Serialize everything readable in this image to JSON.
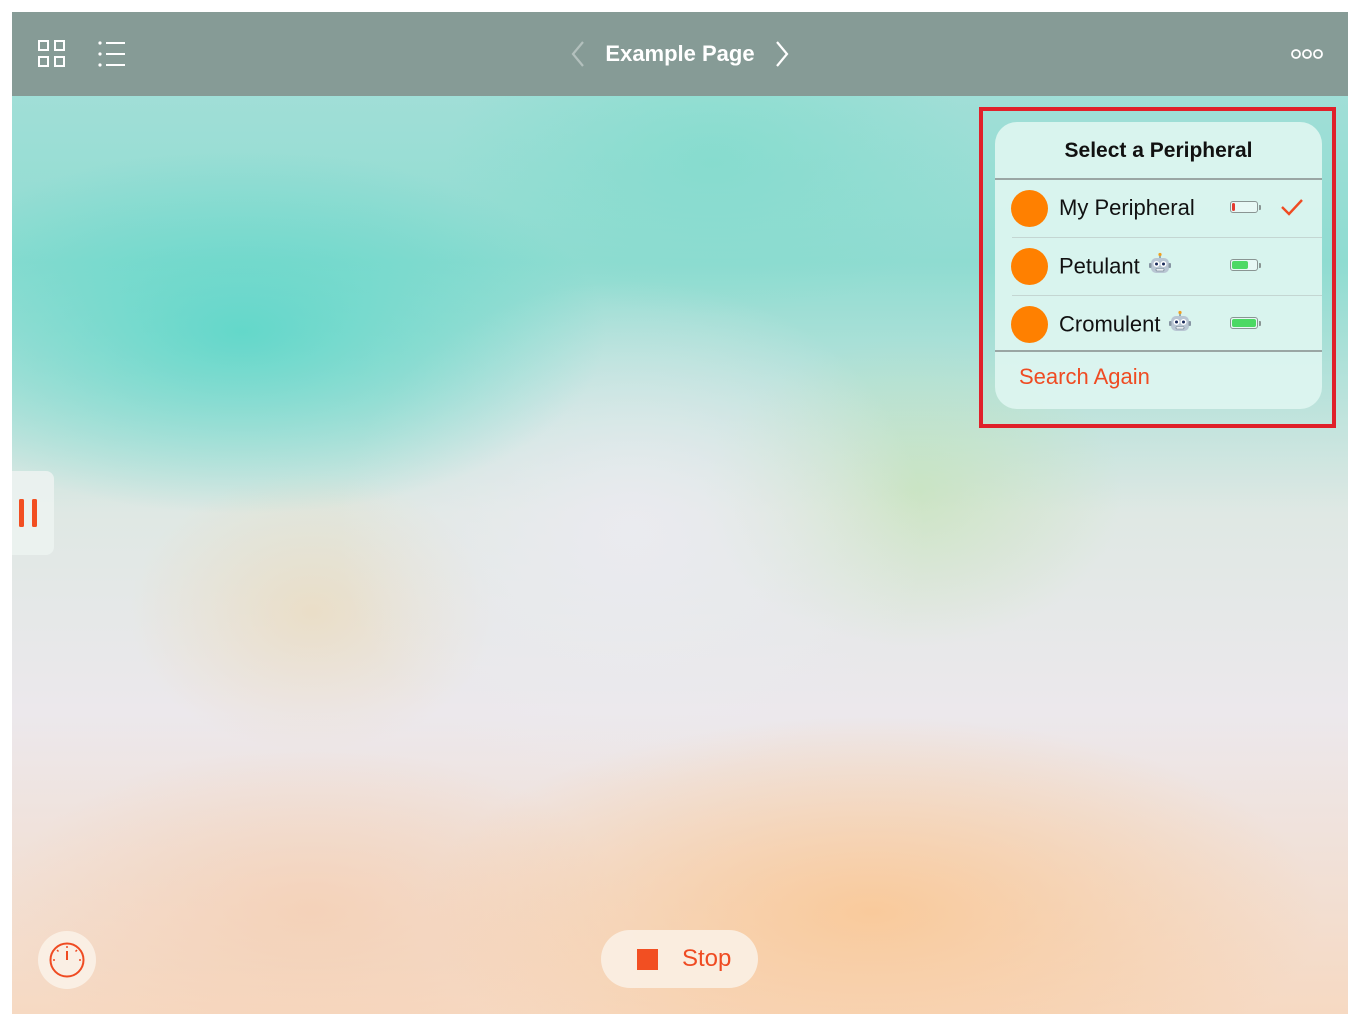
{
  "header": {
    "title": "Example Page"
  },
  "popover": {
    "title": "Select a Peripheral",
    "peripherals": [
      {
        "name": "My Peripheral",
        "robot": false,
        "battery_level": 0.12,
        "battery_color": "#e33a2f",
        "selected": true
      },
      {
        "name": "Petulant",
        "robot": true,
        "battery_level": 0.65,
        "battery_color": "#4cd964",
        "selected": false
      },
      {
        "name": "Cromulent",
        "robot": true,
        "battery_level": 1.0,
        "battery_color": "#4cd964",
        "selected": false
      }
    ],
    "search_again": "Search Again"
  },
  "controls": {
    "stop_label": "Stop"
  },
  "icons": {
    "grid": "grid-icon",
    "list": "list-icon",
    "back": "chevron-left-icon",
    "forward": "chevron-right-icon",
    "more": "more-icon",
    "pause": "pause-icon",
    "gauge": "gauge-icon",
    "stop": "stop-icon",
    "robot": "robot-icon",
    "check": "checkmark-icon"
  },
  "colors": {
    "accent": "#ef4b22",
    "dot": "#ff8000",
    "toolbar": "#869b96",
    "highlight": "#e0202a"
  }
}
